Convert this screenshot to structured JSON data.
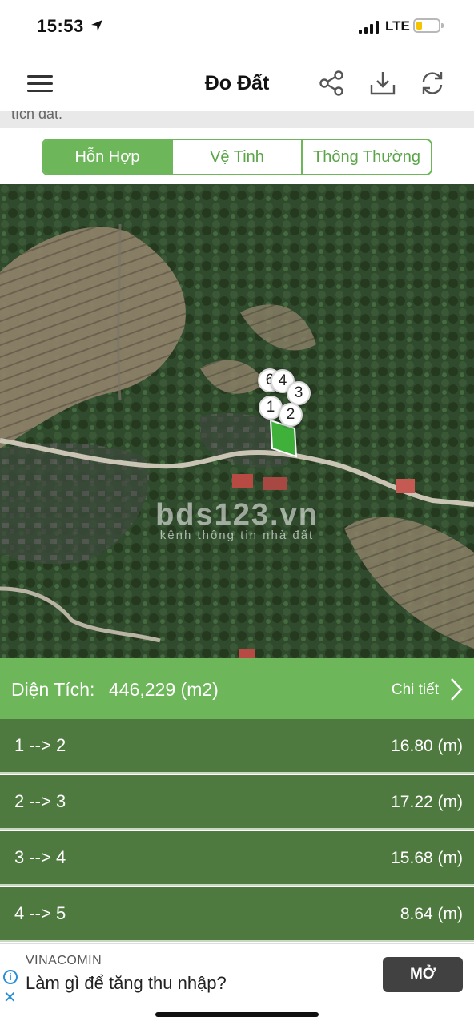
{
  "status": {
    "time": "15:53",
    "network": "LTE",
    "battery_level": 0.25,
    "icons": [
      "location-arrow-icon",
      "signal-icon",
      "battery-icon"
    ]
  },
  "app_bar": {
    "title": "Đo Đất",
    "icons": [
      "menu-icon",
      "share-icon",
      "download-icon",
      "refresh-icon"
    ]
  },
  "scrolled_text": "tích đất.",
  "map_modes": [
    {
      "label": "Hỗn Hợp",
      "active": true
    },
    {
      "label": "Vệ Tinh",
      "active": false
    },
    {
      "label": "Thông Thường",
      "active": false
    }
  ],
  "map": {
    "watermark_main": "bds123.vn",
    "watermark_sub": "kênh thông tin nhà đất",
    "point_labels": [
      "6",
      "4",
      "3",
      "1",
      "2"
    ],
    "polygon_color": "#3fb03a"
  },
  "area": {
    "label": "Diện Tích:",
    "value": "446,229 (m2)",
    "detail_label": "Chi tiết"
  },
  "segments": [
    {
      "from_to": "1 --> 2",
      "length": "16.80 (m)"
    },
    {
      "from_to": "2 --> 3",
      "length": "17.22 (m)"
    },
    {
      "from_to": "3 --> 4",
      "length": "15.68 (m)"
    },
    {
      "from_to": "4 --> 5",
      "length": "8.64 (m)"
    }
  ],
  "ad": {
    "brand": "VINACOMIN",
    "text": "Làm gì để tăng thu nhập?",
    "button": "MỞ"
  },
  "colors": {
    "accent": "#6db65a",
    "row_dark": "#4f7a3f",
    "ad_button": "#414141"
  }
}
